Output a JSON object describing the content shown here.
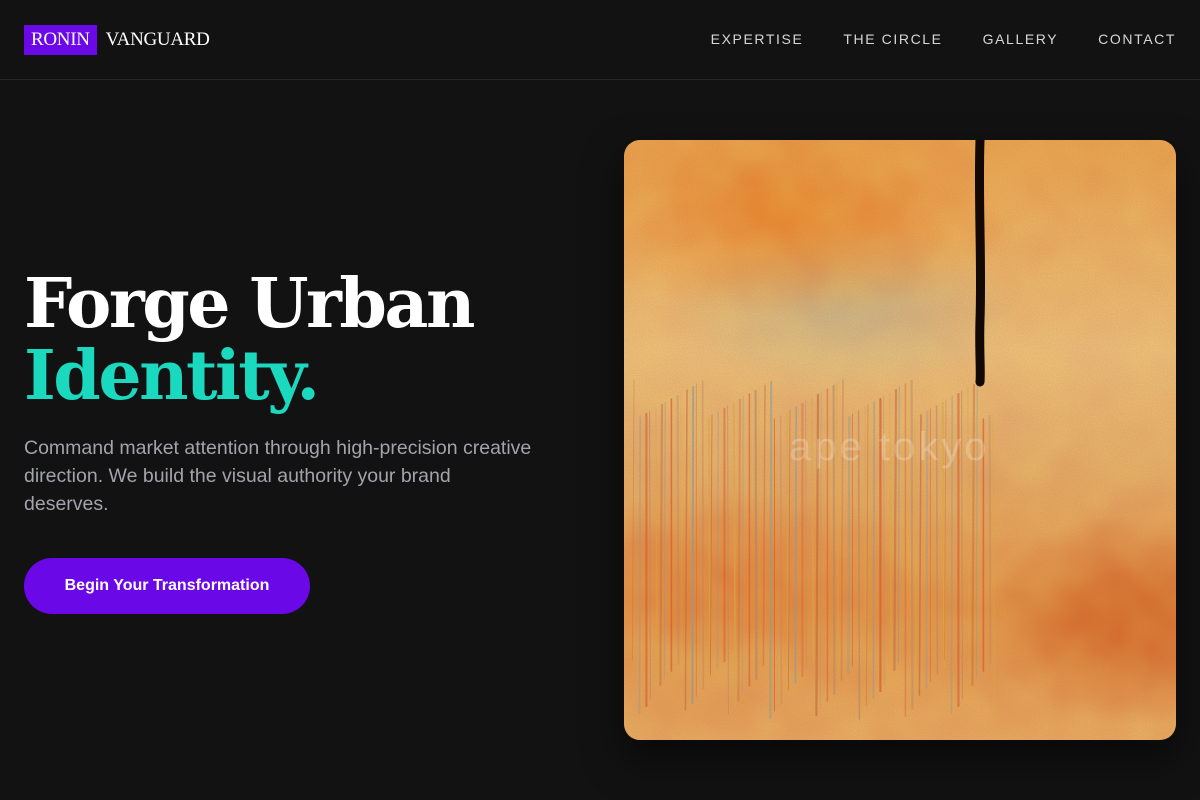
{
  "brand": {
    "highlight": "RONIN",
    "rest": "VANGUARD",
    "accent_color": "#6b08e8"
  },
  "nav": {
    "items": [
      {
        "label": "EXPERTISE"
      },
      {
        "label": "THE CIRCLE"
      },
      {
        "label": "GALLERY"
      },
      {
        "label": "CONTACT"
      }
    ]
  },
  "hero": {
    "title_line1": "Forge Urban",
    "title_line2": "Identity.",
    "title_accent_color": "#1ad9bf",
    "description": "Command market attention through high-precision creative direction. We build the visual authority your brand deserves.",
    "cta_label": "Begin Your Transformation"
  },
  "artwork": {
    "kind": "textured orange abstract painting",
    "watermark": "ape tokyo"
  }
}
